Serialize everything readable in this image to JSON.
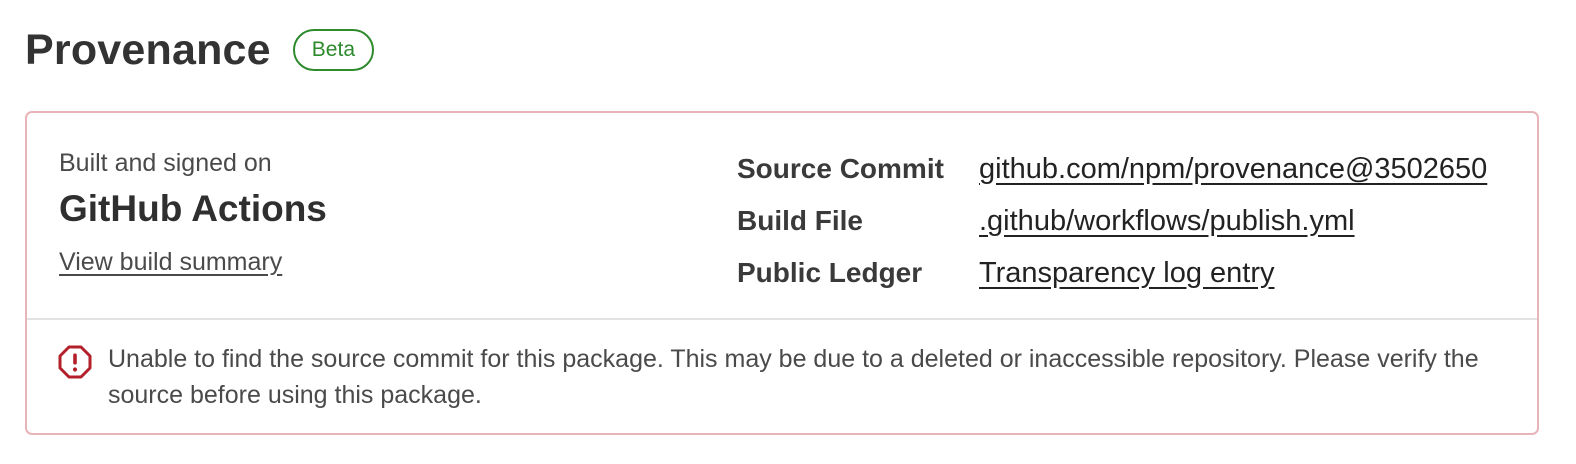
{
  "header": {
    "title": "Provenance",
    "badge": "Beta"
  },
  "summary": {
    "built_label": "Built and signed on",
    "platform": "GitHub Actions",
    "view_link": "View build summary"
  },
  "details": [
    {
      "label": "Source Commit",
      "value": "github.com/npm/provenance@3502650"
    },
    {
      "label": "Build File",
      "value": ".github/workflows/publish.yml"
    },
    {
      "label": "Public Ledger",
      "value": "Transparency log entry"
    }
  ],
  "warning": {
    "icon": "alert-octagon-icon",
    "text": "Unable to find the source commit for this package. This may be due to a deleted or inaccessible repository. Please verify the source before using this package."
  },
  "colors": {
    "badge": "#2d8a2d",
    "card_border": "#e8b4b8",
    "warning_icon": "#b3202a"
  }
}
